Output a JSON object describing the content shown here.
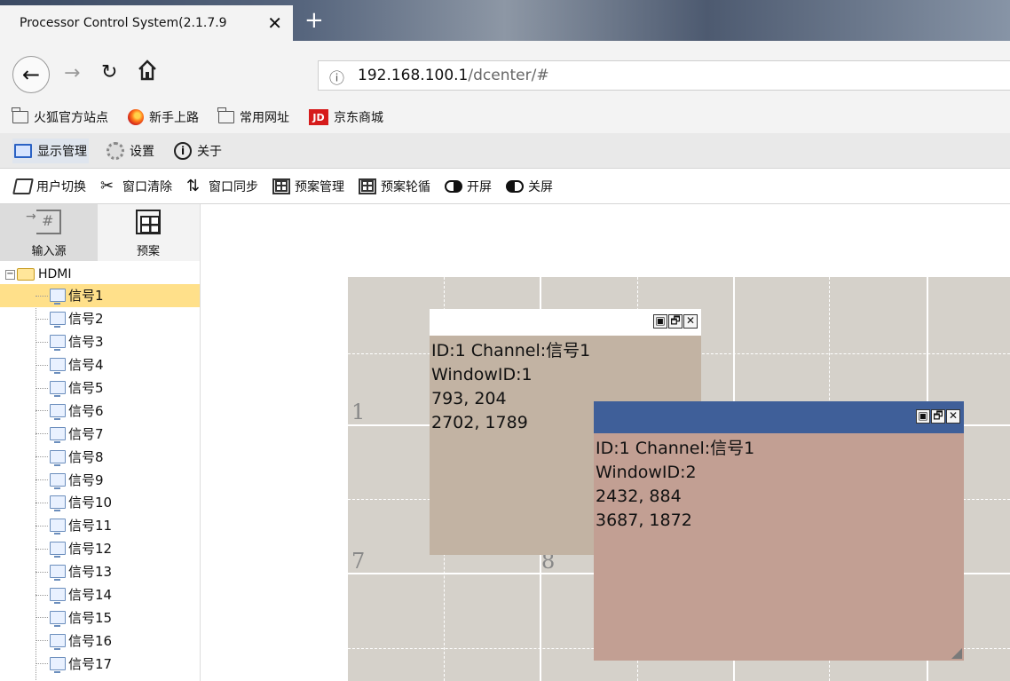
{
  "browser": {
    "tab_title": "Processor Control System(2.1.7.9",
    "tab_close": "✕",
    "new_tab": "+",
    "url_info": "ⓘ",
    "url_host": "192.168.100.1",
    "url_path": "/dcenter/#"
  },
  "bookmarks": [
    {
      "label": "火狐官方站点",
      "icon": "folder-icon"
    },
    {
      "label": "新手上路",
      "icon": "firefox-icon"
    },
    {
      "label": "常用网址",
      "icon": "folder-icon"
    },
    {
      "label": "京东商城",
      "icon": "jd-icon",
      "badge": "JD"
    }
  ],
  "menu": {
    "display": "显示管理",
    "settings": "设置",
    "about": "关于"
  },
  "toolbar": {
    "user_switch": "用户切换",
    "window_clear": "窗口清除",
    "window_sync": "窗口同步",
    "plan_manage": "预案管理",
    "plan_cycle": "预案轮循",
    "screen_on": "开屏",
    "screen_off": "关屏"
  },
  "left_tabs": {
    "input_source": "输入源",
    "plan": "预案"
  },
  "tree": {
    "root": "HDMI",
    "collapse_symbol": "−",
    "items": [
      "信号1",
      "信号2",
      "信号3",
      "信号4",
      "信号5",
      "信号6",
      "信号7",
      "信号8",
      "信号9",
      "信号10",
      "信号11",
      "信号12",
      "信号13",
      "信号14",
      "信号15",
      "信号16",
      "信号17"
    ],
    "selected": "信号1"
  },
  "canvas": {
    "cell_numbers": [
      "1",
      "7",
      "8"
    ],
    "windows": [
      {
        "id_line": "ID:1  Channel:信号1",
        "window_id": "WindowID:1",
        "pos": "793, 204",
        "size": "2702, 1789"
      },
      {
        "id_line": "ID:1  Channel:信号1",
        "window_id": "WindowID:2",
        "pos": "2432, 884",
        "size": "3687, 1872"
      }
    ],
    "win_buttons": {
      "restore": "▣",
      "maximize": "🗗",
      "close": "✕"
    }
  }
}
